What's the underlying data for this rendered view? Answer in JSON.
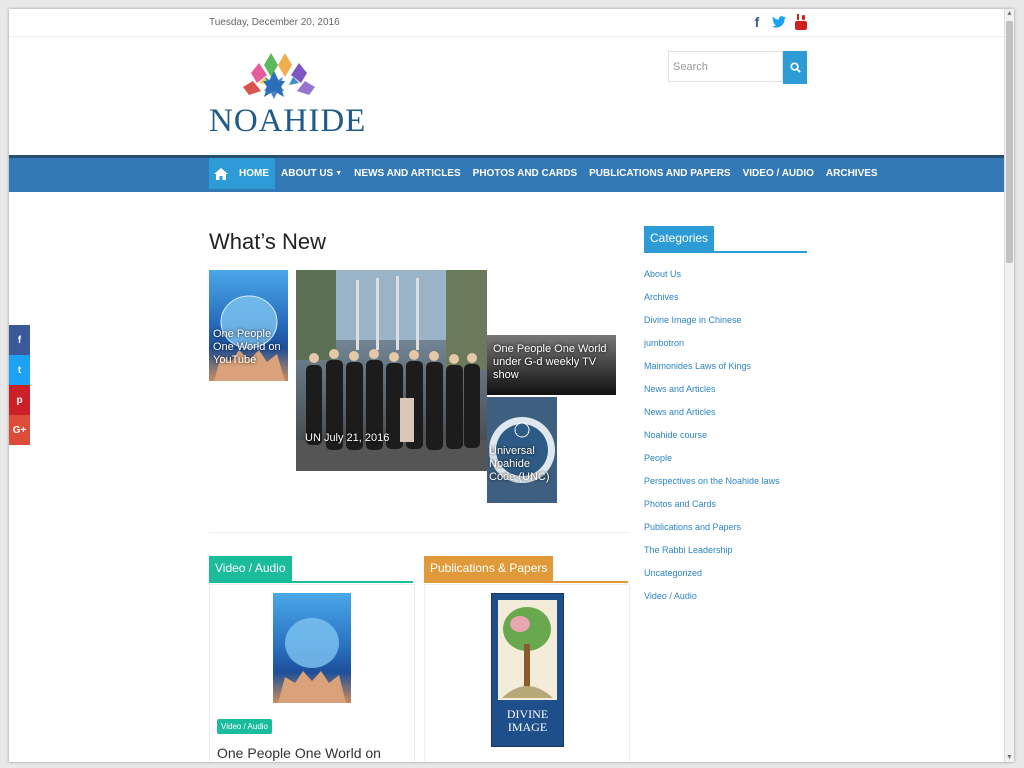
{
  "topbar": {
    "date": "Tuesday, December 20, 2016"
  },
  "social_top": [
    {
      "icon": "facebook-icon",
      "glyph": "f"
    },
    {
      "icon": "twitter-icon",
      "glyph": "t"
    },
    {
      "icon": "youtube-icon",
      "glyph": "▶"
    }
  ],
  "logo": {
    "text": "NOAHIDE"
  },
  "search": {
    "placeholder": "Search"
  },
  "nav": {
    "items": [
      {
        "label": "HOME",
        "active": true
      },
      {
        "label": "ABOUT US"
      },
      {
        "label": "NEWS AND ARTICLES"
      },
      {
        "label": "PHOTOS AND CARDS"
      },
      {
        "label": "PUBLICATIONS AND PAPERS"
      },
      {
        "label": "VIDEO / AUDIO"
      },
      {
        "label": "ARCHIVES"
      }
    ]
  },
  "share_side": [
    "f",
    "t",
    "p",
    "G+"
  ],
  "main": {
    "title": "What’s New",
    "tiles": [
      {
        "caption": "One People One World on YouTube"
      },
      {
        "caption": "UN July 21, 2016"
      },
      {
        "caption": "One People One World under G-d weekly TV show"
      },
      {
        "caption": "Universal Noahide Code (UNC)"
      }
    ]
  },
  "sections": {
    "video": {
      "label": "Video / Audio",
      "tag": "Video / Audio",
      "title": "One People One World on"
    },
    "publications": {
      "label": "Publications & Papers",
      "book_title": "DIVINE IMAGE"
    }
  },
  "sidebar": {
    "heading": "Categories",
    "categories": [
      "About Us",
      "Archives",
      "Divine Image in Chinese",
      "jumbotron",
      "Maimonides Laws of Kings",
      "News and Articles",
      "News and Articles",
      "Noahide course",
      "People",
      "Perspectives on the Noahide laws",
      "Photos and Cards",
      "Publications and Papers",
      "The Rabbi Leadership",
      "Uncategorized",
      "Video / Audio"
    ]
  },
  "colors": {
    "nav": "#3379b7",
    "accent": "#2d9bd6",
    "video": "#1abc9c",
    "publications": "#e09a3a"
  }
}
